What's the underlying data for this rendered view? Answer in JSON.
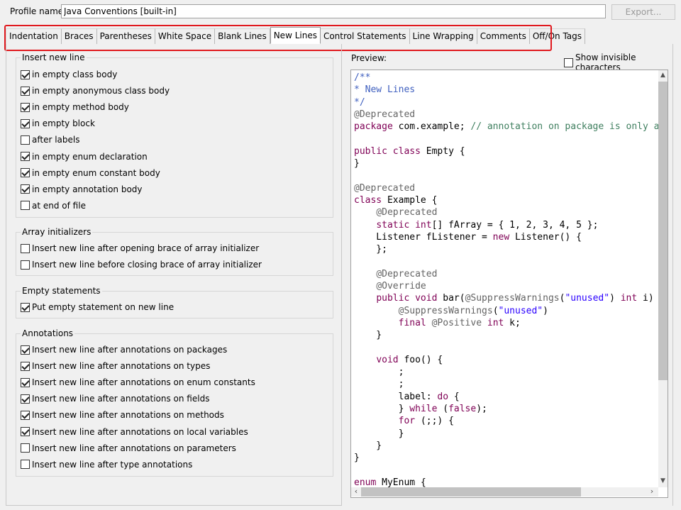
{
  "profile": {
    "label": "Profile name:",
    "value": "Java Conventions [built-in]",
    "export_label": "Export..."
  },
  "tabs": [
    {
      "label": "Indentation",
      "active": false
    },
    {
      "label": "Braces",
      "active": false
    },
    {
      "label": "Parentheses",
      "active": false
    },
    {
      "label": "White Space",
      "active": false
    },
    {
      "label": "Blank Lines",
      "active": false
    },
    {
      "label": "New Lines",
      "active": true
    },
    {
      "label": "Control Statements",
      "active": false
    },
    {
      "label": "Line Wrapping",
      "active": false
    },
    {
      "label": "Comments",
      "active": false
    },
    {
      "label": "Off/On Tags",
      "active": false
    }
  ],
  "groups": {
    "insert_new_line": {
      "title": "Insert new line",
      "items": [
        {
          "label": "in empty class body",
          "checked": true
        },
        {
          "label": "in empty anonymous class body",
          "checked": true
        },
        {
          "label": "in empty method body",
          "checked": true
        },
        {
          "label": "in empty block",
          "checked": true
        },
        {
          "label": "after labels",
          "checked": false
        },
        {
          "label": "in empty enum declaration",
          "checked": true
        },
        {
          "label": "in empty enum constant body",
          "checked": true
        },
        {
          "label": "in empty annotation body",
          "checked": true
        },
        {
          "label": "at end of file",
          "checked": false
        }
      ]
    },
    "array_initializers": {
      "title": "Array initializers",
      "items": [
        {
          "label": "Insert new line after opening brace of array initializer",
          "checked": false
        },
        {
          "label": "Insert new line before closing brace of array initializer",
          "checked": false
        }
      ]
    },
    "empty_statements": {
      "title": "Empty statements",
      "items": [
        {
          "label": "Put empty statement on new line",
          "checked": true
        }
      ]
    },
    "annotations": {
      "title": "Annotations",
      "items": [
        {
          "label": "Insert new line after annotations on packages",
          "checked": true
        },
        {
          "label": "Insert new line after annotations on types",
          "checked": true
        },
        {
          "label": "Insert new line after annotations on enum constants",
          "checked": true
        },
        {
          "label": "Insert new line after annotations on fields",
          "checked": true
        },
        {
          "label": "Insert new line after annotations on methods",
          "checked": true
        },
        {
          "label": "Insert new line after annotations on local variables",
          "checked": true
        },
        {
          "label": "Insert new line after annotations on parameters",
          "checked": false
        },
        {
          "label": "Insert new line after type annotations",
          "checked": false
        }
      ]
    }
  },
  "preview": {
    "label": "Preview:",
    "show_invisible_label": "Show invisible characters",
    "show_invisible_checked": false,
    "code_lines": [
      [
        [
          "doc",
          "/**"
        ]
      ],
      [
        [
          "doc",
          "* New Lines"
        ]
      ],
      [
        [
          "doc",
          "*/"
        ]
      ],
      [
        [
          "ann",
          "@Deprecated"
        ]
      ],
      [
        [
          "kw",
          "package"
        ],
        [
          "pl",
          " com.example; "
        ],
        [
          "cm",
          "// annotation on package is only allowed in"
        ]
      ],
      [],
      [
        [
          "kw",
          "public"
        ],
        [
          "pl",
          " "
        ],
        [
          "kw",
          "class"
        ],
        [
          "pl",
          " Empty {"
        ]
      ],
      [
        [
          "pl",
          "}"
        ]
      ],
      [],
      [
        [
          "ann",
          "@Deprecated"
        ]
      ],
      [
        [
          "kw",
          "class"
        ],
        [
          "pl",
          " Example {"
        ]
      ],
      [
        [
          "pl",
          "    "
        ],
        [
          "ann",
          "@Deprecated"
        ]
      ],
      [
        [
          "pl",
          "    "
        ],
        [
          "kw",
          "static"
        ],
        [
          "pl",
          " "
        ],
        [
          "kw",
          "int"
        ],
        [
          "pl",
          "[] fArray = { 1, 2, 3, 4, 5 };"
        ]
      ],
      [
        [
          "pl",
          "    Listener fListener = "
        ],
        [
          "kw",
          "new"
        ],
        [
          "pl",
          " Listener() {"
        ]
      ],
      [
        [
          "pl",
          "    };"
        ]
      ],
      [],
      [
        [
          "pl",
          "    "
        ],
        [
          "ann",
          "@Deprecated"
        ]
      ],
      [
        [
          "pl",
          "    "
        ],
        [
          "ann",
          "@Override"
        ]
      ],
      [
        [
          "pl",
          "    "
        ],
        [
          "kw",
          "public"
        ],
        [
          "pl",
          " "
        ],
        [
          "kw",
          "void"
        ],
        [
          "pl",
          " bar("
        ],
        [
          "ann",
          "@SuppressWarnings"
        ],
        [
          "pl",
          "("
        ],
        [
          "str",
          "\"unused\""
        ],
        [
          "pl",
          ") "
        ],
        [
          "kw",
          "int"
        ],
        [
          "pl",
          " i) {"
        ]
      ],
      [
        [
          "pl",
          "        "
        ],
        [
          "ann",
          "@SuppressWarnings"
        ],
        [
          "pl",
          "("
        ],
        [
          "str",
          "\"unused\""
        ],
        [
          "pl",
          ")"
        ]
      ],
      [
        [
          "pl",
          "        "
        ],
        [
          "kw",
          "final"
        ],
        [
          "pl",
          " "
        ],
        [
          "ann",
          "@Positive"
        ],
        [
          "pl",
          " "
        ],
        [
          "kw",
          "int"
        ],
        [
          "pl",
          " k;"
        ]
      ],
      [
        [
          "pl",
          "    }"
        ]
      ],
      [],
      [
        [
          "pl",
          "    "
        ],
        [
          "kw",
          "void"
        ],
        [
          "pl",
          " foo() {"
        ]
      ],
      [
        [
          "pl",
          "        ;"
        ]
      ],
      [
        [
          "pl",
          "        ;"
        ]
      ],
      [
        [
          "pl",
          "        label: "
        ],
        [
          "kw",
          "do"
        ],
        [
          "pl",
          " {"
        ]
      ],
      [
        [
          "pl",
          "        } "
        ],
        [
          "kw",
          "while"
        ],
        [
          "pl",
          " ("
        ],
        [
          "kw",
          "false"
        ],
        [
          "pl",
          ");"
        ]
      ],
      [
        [
          "pl",
          "        "
        ],
        [
          "kw",
          "for"
        ],
        [
          "pl",
          " (;;) {"
        ]
      ],
      [
        [
          "pl",
          "        }"
        ]
      ],
      [
        [
          "pl",
          "    }"
        ]
      ],
      [
        [
          "pl",
          "}"
        ]
      ],
      [],
      [
        [
          "kw",
          "enum"
        ],
        [
          "pl",
          " MyEnum {"
        ]
      ]
    ]
  }
}
